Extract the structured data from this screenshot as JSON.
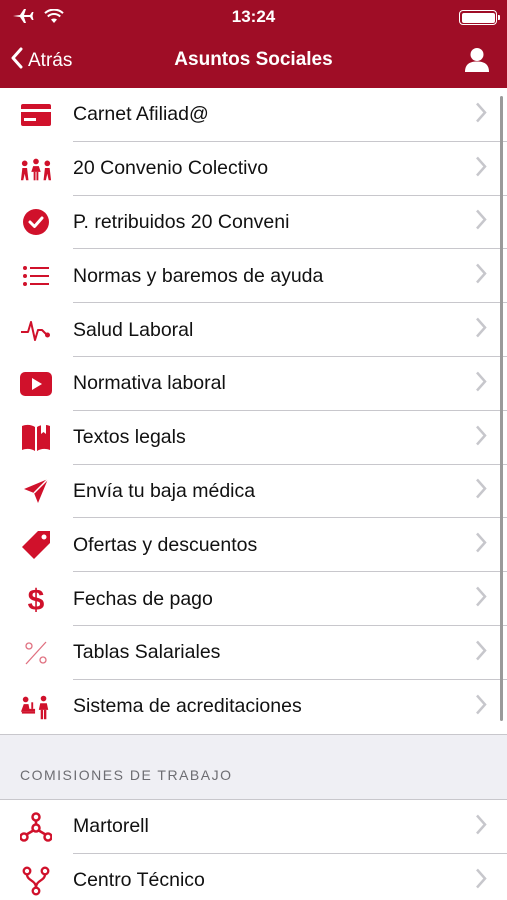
{
  "status_bar": {
    "time": "13:24"
  },
  "nav": {
    "back_label": "Atrás",
    "title": "Asuntos Sociales"
  },
  "menu": [
    {
      "label": "Carnet Afiliad@",
      "icon": "card-icon"
    },
    {
      "label": "20 Convenio Colectivo",
      "icon": "people-icon"
    },
    {
      "label": "P. retribuidos 20 Conveni",
      "icon": "checkmark-circle-icon"
    },
    {
      "label": "Normas y baremos de ayuda",
      "icon": "list-icon"
    },
    {
      "label": "Salud Laboral",
      "icon": "heartbeat-icon"
    },
    {
      "label": "Normativa laboral",
      "icon": "video-play-icon"
    },
    {
      "label": "Textos legals",
      "icon": "book-icon"
    },
    {
      "label": "Envía tu baja médica",
      "icon": "send-icon"
    },
    {
      "label": "Ofertas y descuentos",
      "icon": "tag-icon"
    },
    {
      "label": "Fechas de pago",
      "icon": "dollar-icon"
    },
    {
      "label": "Tablas Salariales",
      "icon": "percent-icon"
    },
    {
      "label": "Sistema de acreditaciones",
      "icon": "accreditation-icon"
    }
  ],
  "section2": {
    "title": "COMISIONES DE TRABAJO",
    "items": [
      {
        "label": "Martorell",
        "icon": "network-icon"
      },
      {
        "label": "Centro Técnico",
        "icon": "branch-icon"
      }
    ]
  },
  "colors": {
    "brand": "#9f0d26",
    "icon": "#d0112b"
  }
}
